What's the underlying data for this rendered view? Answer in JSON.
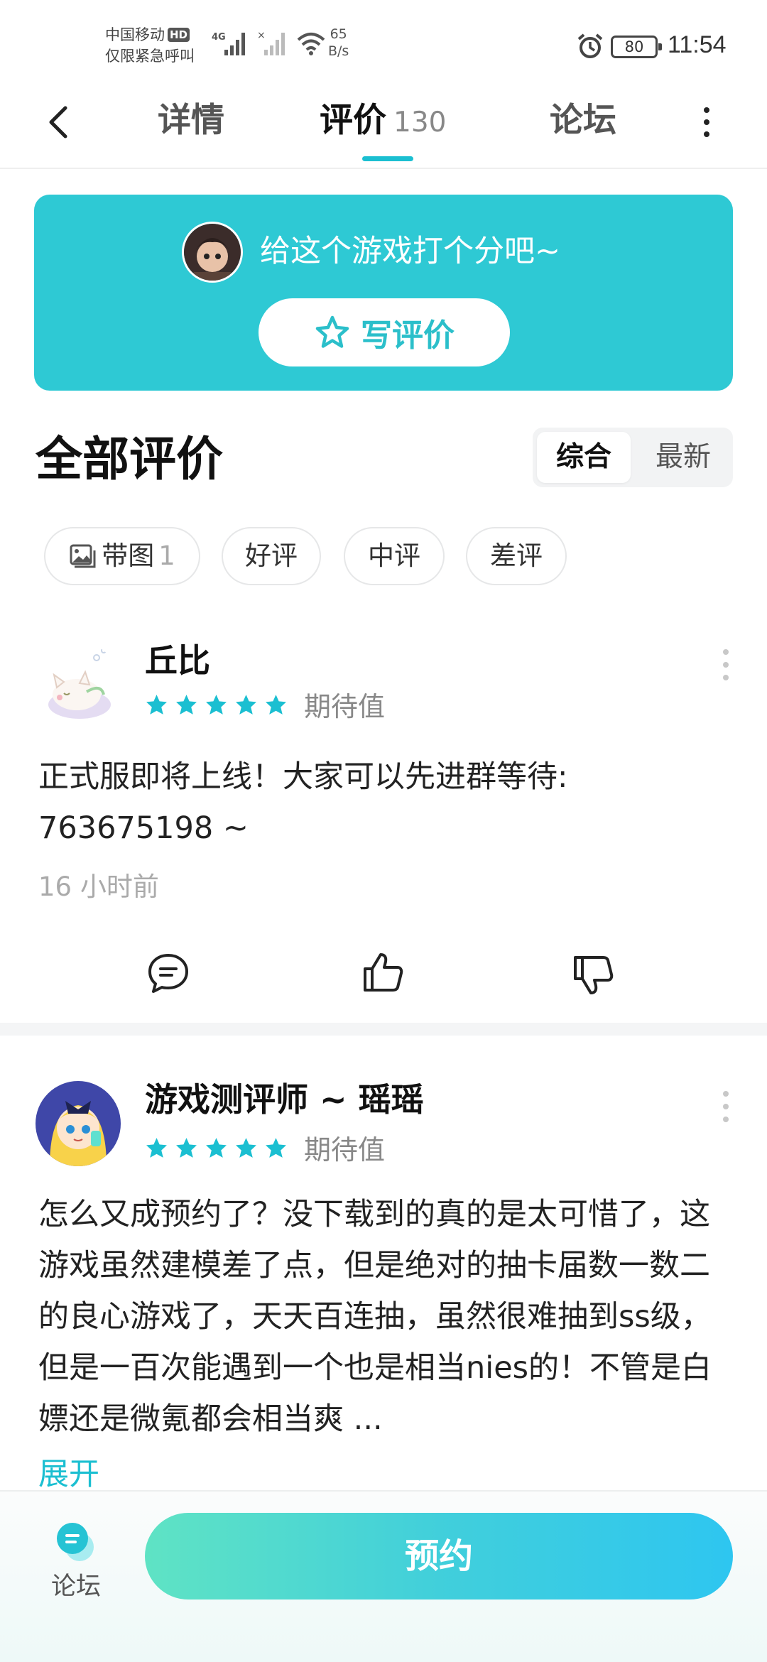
{
  "status_bar": {
    "carrier": "中国移动",
    "hd": "HD",
    "emergency": "仅限紧急呼叫",
    "network": "4G",
    "speed_value": "65",
    "speed_unit": "B/s",
    "battery": "80",
    "time": "11:54"
  },
  "nav": {
    "tabs": [
      {
        "label": "详情"
      },
      {
        "label": "评价",
        "count": "130"
      },
      {
        "label": "论坛"
      }
    ],
    "active_tab": "评价"
  },
  "banner": {
    "prompt": "给这个游戏打个分吧~",
    "button": "写评价",
    "color": "#2ec9d4"
  },
  "section": {
    "title": "全部评价",
    "sort_options": [
      "综合",
      "最新"
    ],
    "selected_sort": "综合"
  },
  "filters": [
    {
      "label": "带图",
      "count": "1",
      "icon": "image-icon"
    },
    {
      "label": "好评"
    },
    {
      "label": "中评"
    },
    {
      "label": "差评"
    }
  ],
  "reviews": [
    {
      "username": "丘比",
      "rating": 5,
      "tag": "期待值",
      "content": "正式服即将上线！大家可以先进群等待: 763675198 ~",
      "time": "16 小时前"
    },
    {
      "username": "游戏测评师 ~ 瑶瑶",
      "rating": 5,
      "tag": "期待值",
      "content": "怎么又成预约了？没下载到的真的是太可惜了，这游戏虽然建模差了点，但是绝对的抽卡届数一数二的良心游戏了，天天百连抽，虽然很难抽到ss级，但是一百次能遇到一个也是相当nies的！不管是白嫖还是微氪都会相当爽 ...",
      "expand": "展开"
    }
  ],
  "bottom_bar": {
    "forum_label": "论坛",
    "action_button": "预约"
  },
  "colors": {
    "accent": "#1bbfd1",
    "star": "#1bbfd1"
  }
}
